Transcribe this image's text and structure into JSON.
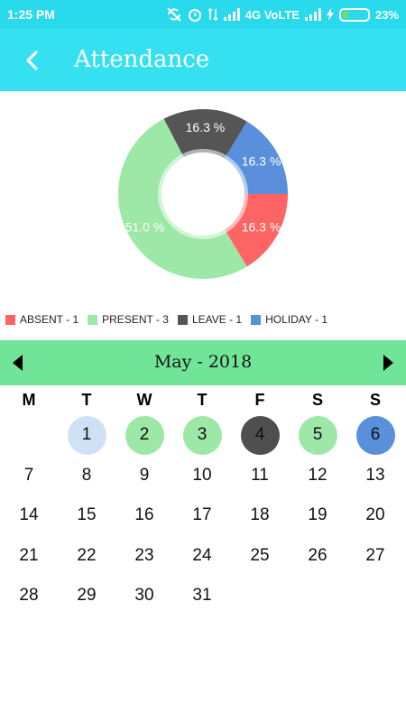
{
  "status_bar": {
    "time": "1:25 PM",
    "network_label": "4G VoLTE",
    "battery_percent": "23%",
    "battery_level": 0.23
  },
  "app_bar": {
    "title": "Attendance",
    "back_icon": "back-chevron-icon"
  },
  "chart_data": {
    "type": "pie",
    "donut": true,
    "slices": [
      {
        "name": "ABSENT",
        "value": 16.3,
        "label": "16.3 %",
        "color": "#fe6464"
      },
      {
        "name": "PRESENT",
        "value": 51.0,
        "label": "51.0 %",
        "color": "#9de8a7"
      },
      {
        "name": "LEAVE",
        "value": 16.3,
        "label": "16.3 %",
        "color": "#555555"
      },
      {
        "name": "HOLIDAY",
        "value": 16.3,
        "label": "16.3 %",
        "color": "#5a8fdc"
      }
    ],
    "legend_position": "bottom-left"
  },
  "legend": [
    {
      "label": "ABSENT - 1",
      "color": "#fe6464"
    },
    {
      "label": "PRESENT - 3",
      "color": "#9de8a7"
    },
    {
      "label": "LEAVE - 1",
      "color": "#555555"
    },
    {
      "label": "HOLIDAY - 1",
      "color": "#5a8fdc"
    }
  ],
  "calendar": {
    "month_label": "May - 2018",
    "weekdays": [
      "M",
      "T",
      "W",
      "T",
      "F",
      "S",
      "S"
    ],
    "weeks": [
      [
        {
          "d": ""
        },
        {
          "d": "1",
          "s": "today"
        },
        {
          "d": "2",
          "s": "present"
        },
        {
          "d": "3",
          "s": "present"
        },
        {
          "d": "4",
          "s": "leave"
        },
        {
          "d": "5",
          "s": "present"
        },
        {
          "d": "6",
          "s": "holiday"
        }
      ],
      [
        {
          "d": "7"
        },
        {
          "d": "8"
        },
        {
          "d": "9"
        },
        {
          "d": "10"
        },
        {
          "d": "11"
        },
        {
          "d": "12"
        },
        {
          "d": "13"
        }
      ],
      [
        {
          "d": "14"
        },
        {
          "d": "15"
        },
        {
          "d": "16"
        },
        {
          "d": "17"
        },
        {
          "d": "18"
        },
        {
          "d": "19"
        },
        {
          "d": "20"
        }
      ],
      [
        {
          "d": "21"
        },
        {
          "d": "22"
        },
        {
          "d": "23"
        },
        {
          "d": "24"
        },
        {
          "d": "25"
        },
        {
          "d": "26"
        },
        {
          "d": "27"
        }
      ],
      [
        {
          "d": "28"
        },
        {
          "d": "29"
        },
        {
          "d": "30"
        },
        {
          "d": "31"
        },
        {
          "d": ""
        },
        {
          "d": ""
        },
        {
          "d": ""
        }
      ]
    ],
    "status_colors": {
      "today": "#cfe2f5",
      "present": "#9de8a7",
      "leave": "#4f4f4f",
      "holiday": "#5a8fdc"
    }
  },
  "colors": {
    "status_bar_bg": "#29d9ec",
    "app_bar_bg": "#35e0f1",
    "calendar_header_bg": "#71e597"
  }
}
